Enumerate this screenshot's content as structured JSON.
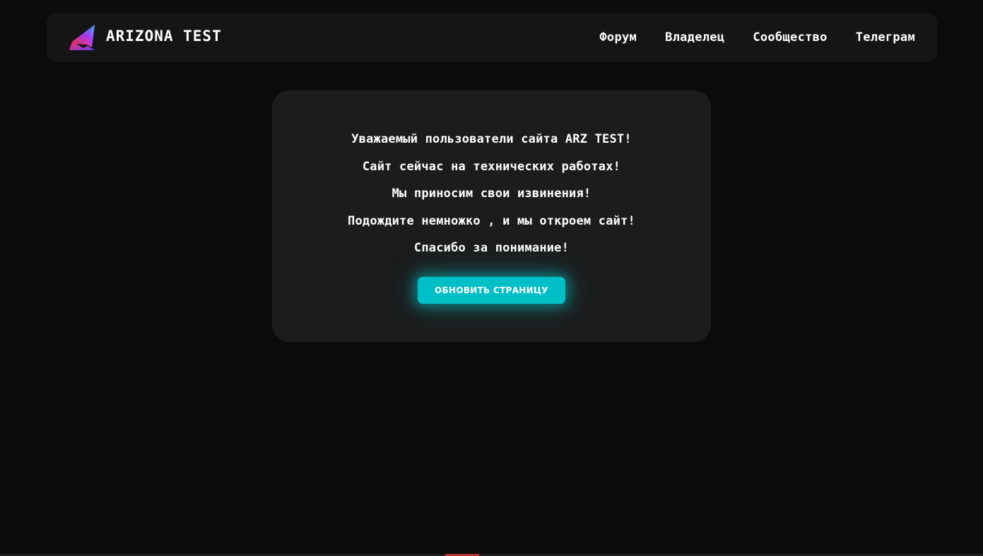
{
  "brand": {
    "name": "ARIZONA TEST",
    "logo_icon": "arizona-logo-icon"
  },
  "nav": {
    "items": [
      {
        "label": "Форум"
      },
      {
        "label": "Владелец"
      },
      {
        "label": "Сообщество"
      },
      {
        "label": "Телеграм"
      }
    ]
  },
  "notice": {
    "lines": [
      "Уважаемый пользователи сайта ARZ TEST!",
      "Сайт сейчас на технических работах!",
      "Мы приносим свои извинения!",
      "Подождите немножко , и мы откроем сайт!",
      "Спасибо за понимание!"
    ],
    "button_label": "ОБНОВИТЬ СТРАНИЦУ"
  },
  "colors": {
    "background": "#0b0b0b",
    "navbar": "#151515",
    "card": "#1c1c1c",
    "accent": "#00bfc6",
    "indicator": "#b3322b"
  }
}
